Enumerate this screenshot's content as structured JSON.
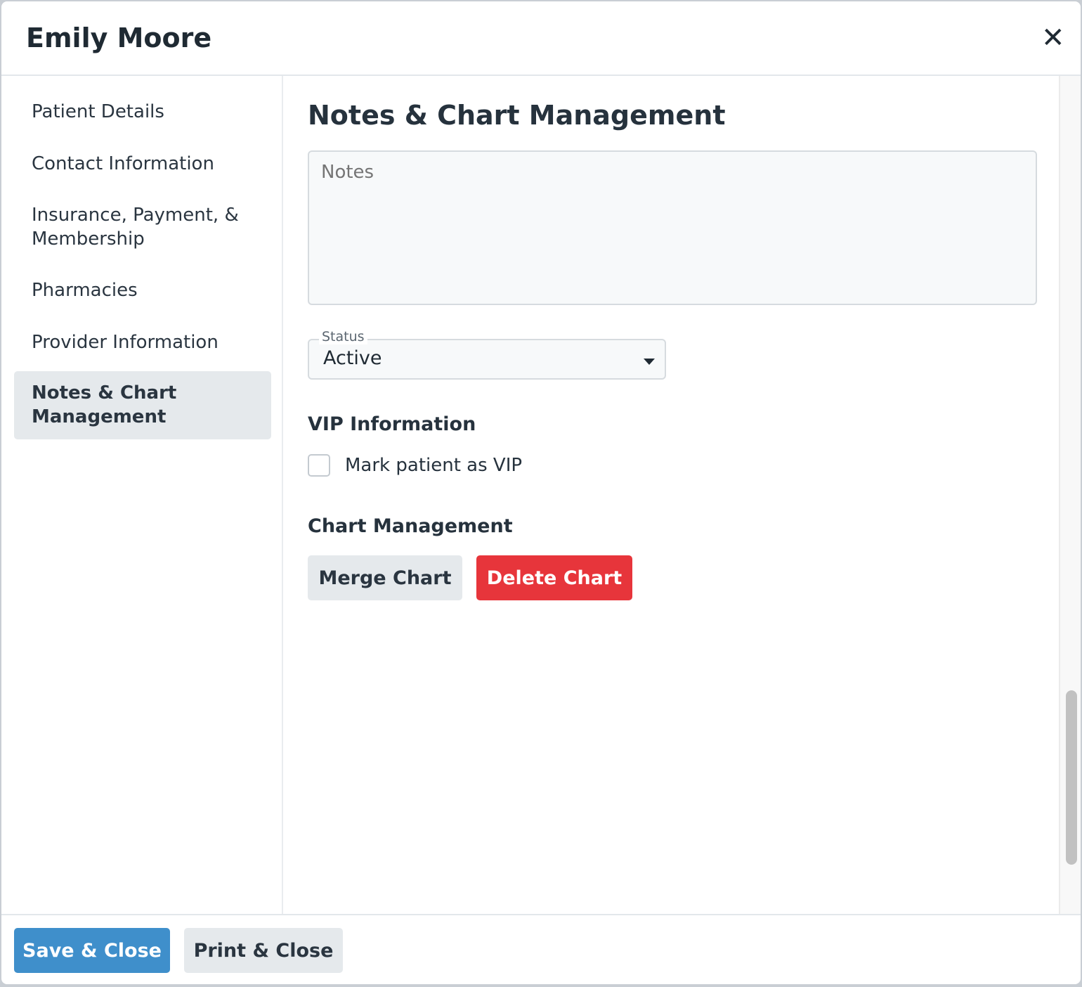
{
  "header": {
    "title": "Emily Moore",
    "close_icon": "close-icon"
  },
  "sidebar": {
    "items": [
      {
        "label": "Patient Details"
      },
      {
        "label": "Contact Information"
      },
      {
        "label": "Insurance, Payment, & Membership"
      },
      {
        "label": "Pharmacies"
      },
      {
        "label": "Provider Information"
      },
      {
        "label": "Notes & Chart Management",
        "active": true
      }
    ]
  },
  "main": {
    "title": "Notes & Chart Management",
    "notes": {
      "placeholder": "Notes",
      "value": ""
    },
    "status": {
      "label": "Status",
      "value": "Active"
    },
    "vip": {
      "heading": "VIP Information",
      "checkbox_label": "Mark patient as VIP",
      "checked": false
    },
    "chart": {
      "heading": "Chart Management",
      "merge_label": "Merge Chart",
      "delete_label": "Delete Chart"
    }
  },
  "footer": {
    "save_label": "Save & Close",
    "print_label": "Print & Close"
  },
  "colors": {
    "primary": "#3f8fcb",
    "danger": "#e7353b",
    "active_nav": "#e5e9ec"
  }
}
